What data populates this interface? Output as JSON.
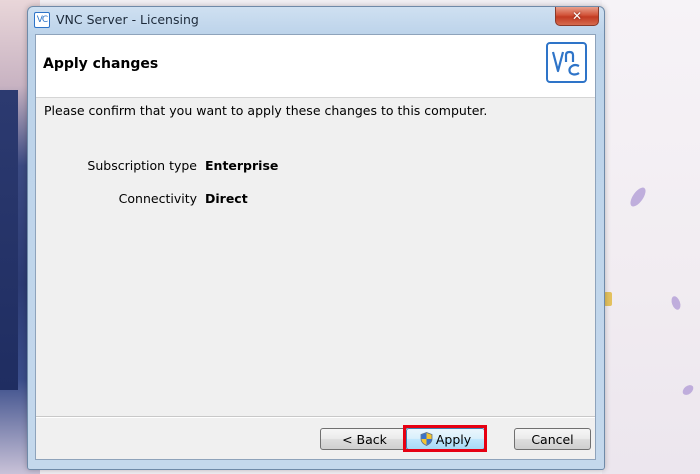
{
  "window": {
    "title": "VNC Server - Licensing",
    "close_label": "✕",
    "app_icon_text": "VC"
  },
  "page": {
    "heading": "Apply changes",
    "intro": "Please confirm that you want to apply these changes to this computer.",
    "fields": [
      {
        "label": "Subscription type",
        "value": "Enterprise"
      },
      {
        "label": "Connectivity",
        "value": "Direct"
      }
    ]
  },
  "buttons": {
    "back": "< Back",
    "apply": "Apply",
    "cancel": "Cancel"
  },
  "colors": {
    "brand": "#2e74c8",
    "highlight": "#e60012"
  }
}
